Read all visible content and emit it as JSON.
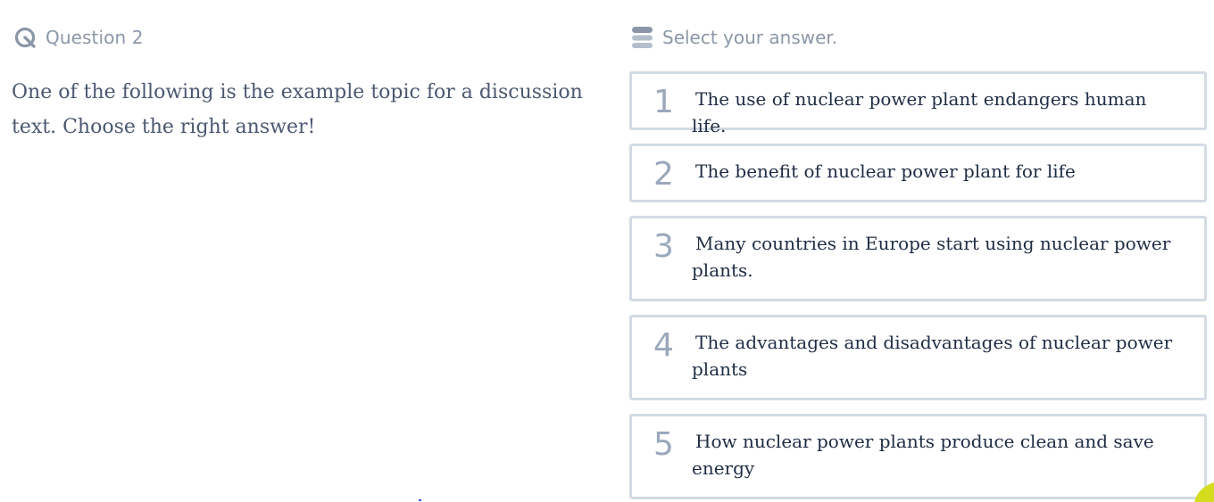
{
  "question": {
    "icon": "timer-icon",
    "label": "Question 2",
    "text": "One of the following is the example topic for a discussion text. Choose the right answer!"
  },
  "answers": {
    "icon": "list-icon",
    "label": "Select your answer.",
    "options": [
      {
        "number": "1",
        "text": "The use of nuclear power plant endangers human life."
      },
      {
        "number": "2",
        "text": "The benefit of nuclear power plant for life"
      },
      {
        "number": "3",
        "text": "Many countries in Europe start using nuclear power plants."
      },
      {
        "number": "4",
        "text": "The advantages and disadvantages of nuclear power plants"
      },
      {
        "number": "5",
        "text": "How nuclear power plants produce clean and save energy"
      }
    ]
  },
  "colors": {
    "muted": "#8b97a8",
    "border": "#d3dbe4",
    "number": "#9aa8bc",
    "body_text": "#1f2d44",
    "corner_accent": "#d4dc1c"
  }
}
